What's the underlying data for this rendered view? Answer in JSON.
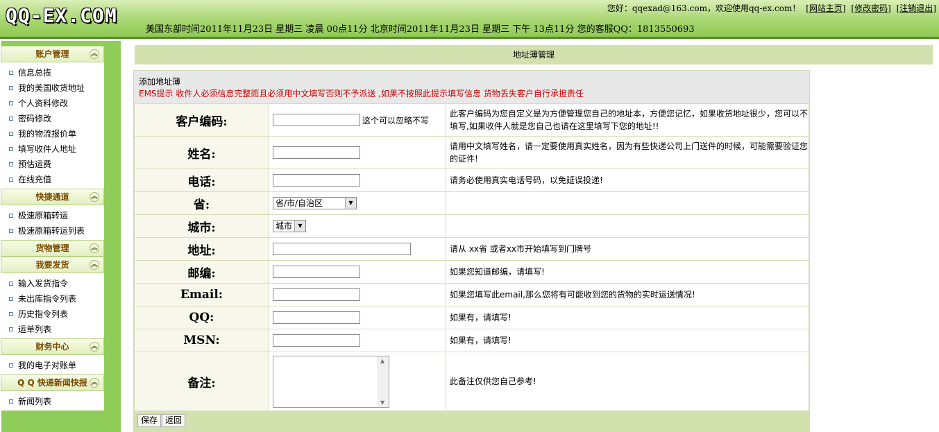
{
  "header": {
    "logo": "QQ-EX.COM",
    "welcome": "您好：qqexad@163.com，欢迎使用qq-ex.com！",
    "links": [
      "[网站主页]",
      "[修改密码]",
      "[注销退出]"
    ],
    "time": "美国东部时间2011年11月23日 星期三 凌晨 00点11分 北京时间2011年11月23日 星期三 下午 13点11分 您的客服QQ：1813550693"
  },
  "sidebar": {
    "groups": [
      {
        "title": "账户管理",
        "items": [
          "信息总揽",
          "我的美国收货地址",
          "个人资料修改",
          "密码修改",
          "我的物流报价单",
          "填写收件人地址",
          "预估运费",
          "在线充值"
        ]
      },
      {
        "title": "快捷通道",
        "items": [
          "极速原箱转运",
          "极速原箱转运列表"
        ]
      },
      {
        "title": "货物管理",
        "items": []
      },
      {
        "title": "我要发货",
        "items": [
          "输入发货指令",
          "未出库指令列表",
          "历史指令列表",
          "运单列表"
        ]
      },
      {
        "title": "财务中心",
        "items": [
          "我的电子对账单"
        ]
      },
      {
        "title": "Q Q 快递新闻快报",
        "items": [
          "新闻列表"
        ]
      }
    ]
  },
  "main": {
    "title": "地址薄管理",
    "form_title": "添加地址薄",
    "warning": "EMS提示 收件人必须信息完整而且必须用中文填写否则不予派送 ,如果不按照此提示填写信息 货物丢失客户自行承担责任",
    "rows": [
      {
        "label": "客户编码:",
        "type": "text",
        "after": "这个可以忽略不写",
        "hint": "此客户编码为您自定义是为方便管理您自己的地址本，方便您记忆，如果收货地址很少，您可以不填写,如果收件人就是您自己也请在这里填写下您的地址!!"
      },
      {
        "label": "姓名:",
        "type": "text",
        "after": "",
        "hint": "请用中文填写姓名，请一定要使用真实姓名，因为有些快递公司上门送件的时候，可能需要验证您的证件!"
      },
      {
        "label": "电话:",
        "type": "text",
        "after": "",
        "hint": "请务必使用真实电话号码，以免延误投递!"
      },
      {
        "label": "省:",
        "type": "select",
        "value": "省/市/自治区",
        "hint": ""
      },
      {
        "label": "城市:",
        "type": "select",
        "value": "城市",
        "hint": ""
      },
      {
        "label": "地址:",
        "type": "wide",
        "after": "",
        "hint": "请从 xx省 或者xx市开始填写到门牌号"
      },
      {
        "label": "邮编:",
        "type": "text",
        "after": "",
        "hint": "如果您知道邮编，请填写!"
      },
      {
        "label": "Email:",
        "type": "text",
        "after": "",
        "hint": "如果您填写此email,那么您将有可能收到您的货物的实时运送情况!"
      },
      {
        "label": "QQ:",
        "type": "text",
        "after": "",
        "hint": "如果有，请填写!"
      },
      {
        "label": "MSN:",
        "type": "text",
        "after": "",
        "hint": "如果有，请填写!"
      },
      {
        "label": "备注:",
        "type": "textarea",
        "after": "",
        "hint": "此备注仅供您自己参考!"
      }
    ],
    "buttons": {
      "save": "保存",
      "back": "返回"
    }
  }
}
